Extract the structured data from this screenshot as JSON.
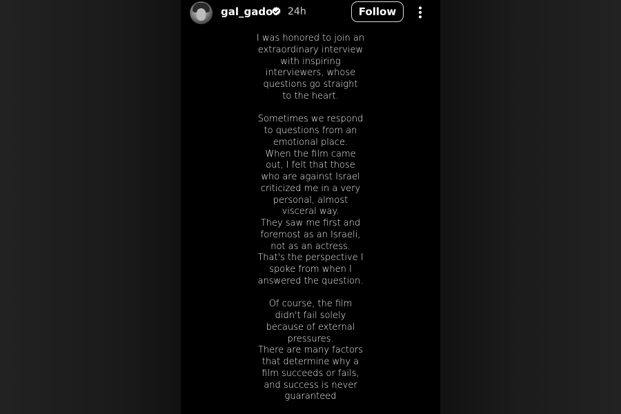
{
  "header": {
    "username": "gal_gadot",
    "verified_icon": "verified-badge-icon",
    "time": "24h",
    "follow_label": "Follow",
    "more_icon": "more-vertical-icon"
  },
  "caption": {
    "paragraphs": [
      [
        "I was honored to join an",
        "extraordinary interview",
        "with inspiring",
        "interviewers, whose",
        "questions go straight",
        "to the heart."
      ],
      [
        "Sometimes we respond",
        "to questions from an",
        "emotional place.",
        "When the film came",
        "out, I felt that those",
        "who are against Israel",
        "criticized me in a very",
        "personal, almost",
        "visceral way.",
        "They saw me first and",
        "foremost as an Israeli,",
        "not as an actress.",
        "That's the perspective I",
        "spoke from when I",
        "answered the question."
      ],
      [
        "Of course, the film",
        "didn't fail solely",
        "because of external",
        "pressures.",
        "There are many factors",
        "that determine why a",
        "film succeeds or fails,",
        "and success is never",
        "guaranteed"
      ]
    ]
  },
  "colors": {
    "background": "#000000",
    "side_panels": "#1e1e1e",
    "text": "#ffffff",
    "verified_badge": "#ffffff"
  }
}
